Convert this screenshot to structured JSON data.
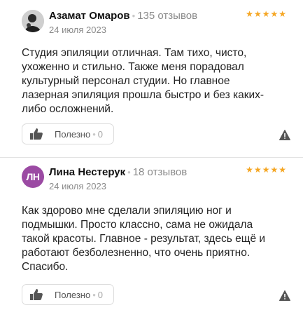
{
  "reviews": [
    {
      "author": "Азамат Омаров",
      "separator": "•",
      "reviews_count": "135 отзывов",
      "date": "24 июля 2023",
      "stars": [
        "★",
        "★",
        "★",
        "★",
        "★"
      ],
      "rating": 5,
      "text": "Студия эпиляции отличная. Там тихо, чисто,\nухоженно и стильно. Также меня порадовал\nкультурный персонал студии. Но главное\nлазерная эпиляция прошла быстро и без каких-\nлибо осложнений.",
      "useful_label": "Полезно",
      "useful_separator": "•",
      "useful_count": "0"
    },
    {
      "author": "Лина Нестерук",
      "initials": "ЛН",
      "separator": "•",
      "reviews_count": "18 отзывов",
      "date": "24 июля 2023",
      "stars": [
        "★",
        "★",
        "★",
        "★",
        "★"
      ],
      "rating": 5,
      "text": "Как здорово мне сделали эпиляцию ног и\nподмышки. Просто классно, сама не ожидала\nтакой красоты. Главное - результат, здесь ещё и\nработают безболезненно, что очень приятно.\nСпасибо.",
      "useful_label": "Полезно",
      "useful_separator": "•",
      "useful_count": "0"
    }
  ],
  "colors": {
    "star": "#f5a623",
    "avatar2": "#9b4aa3",
    "muted": "#8a8a8a"
  },
  "icons": {
    "useful": "thumbs-up-icon",
    "report": "warning-icon"
  }
}
